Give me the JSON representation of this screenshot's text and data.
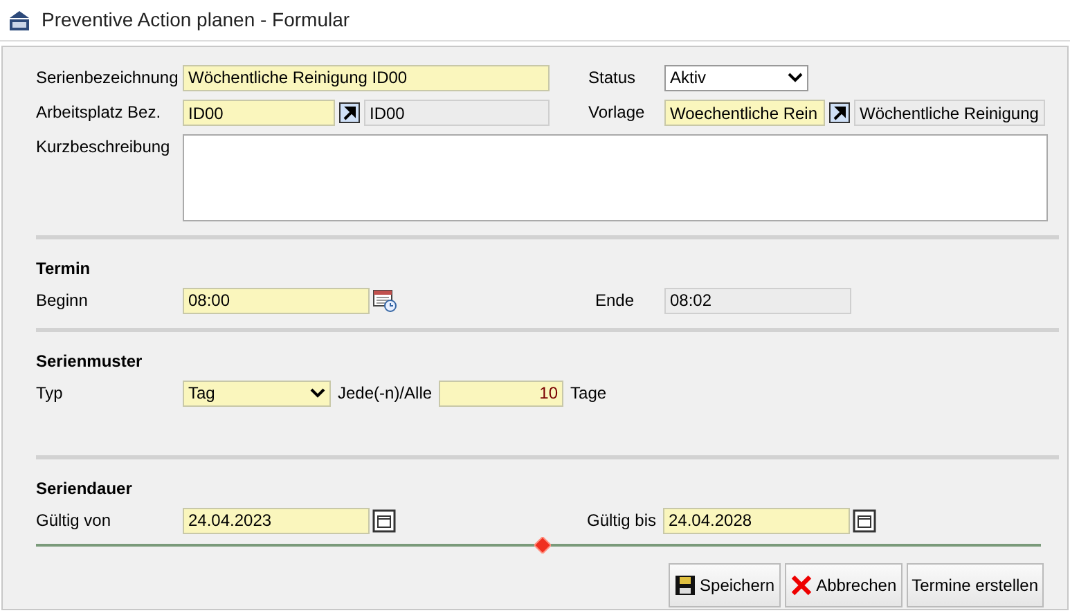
{
  "window": {
    "title": "Preventive Action planen - Formular"
  },
  "general": {
    "series_name": {
      "label": "Serienbezeichnung",
      "value": "Wöchentliche Reinigung ID00"
    },
    "status": {
      "label": "Status",
      "value": "Aktiv"
    },
    "workplace": {
      "label": "Arbeitsplatz Bez.",
      "value": "ID00",
      "display": "ID00"
    },
    "template": {
      "label": "Vorlage",
      "value": "Woechentliche Rein",
      "display": "Wöchentliche Reinigung"
    },
    "description": {
      "label": "Kurzbeschreibung"
    }
  },
  "termin": {
    "heading": "Termin",
    "start": {
      "label": "Beginn",
      "value": "08:00"
    },
    "end": {
      "label": "Ende",
      "value": "08:02"
    }
  },
  "pattern": {
    "heading": "Serienmuster",
    "type": {
      "label": "Typ",
      "value": "Tag"
    },
    "every": {
      "label": "Jede(-n)/Alle",
      "value": "10",
      "unit": "Tage"
    }
  },
  "duration": {
    "heading": "Seriendauer",
    "from": {
      "label": "Gültig von",
      "value": "24.04.2023"
    },
    "to": {
      "label": "Gültig bis",
      "value": "24.04.2028"
    }
  },
  "buttons": [
    {
      "kind": "save",
      "label": "Speichern"
    },
    {
      "kind": "cancel",
      "label": "Abbrechen"
    },
    {
      "kind": "plain",
      "label": "Termine erstellen"
    }
  ]
}
